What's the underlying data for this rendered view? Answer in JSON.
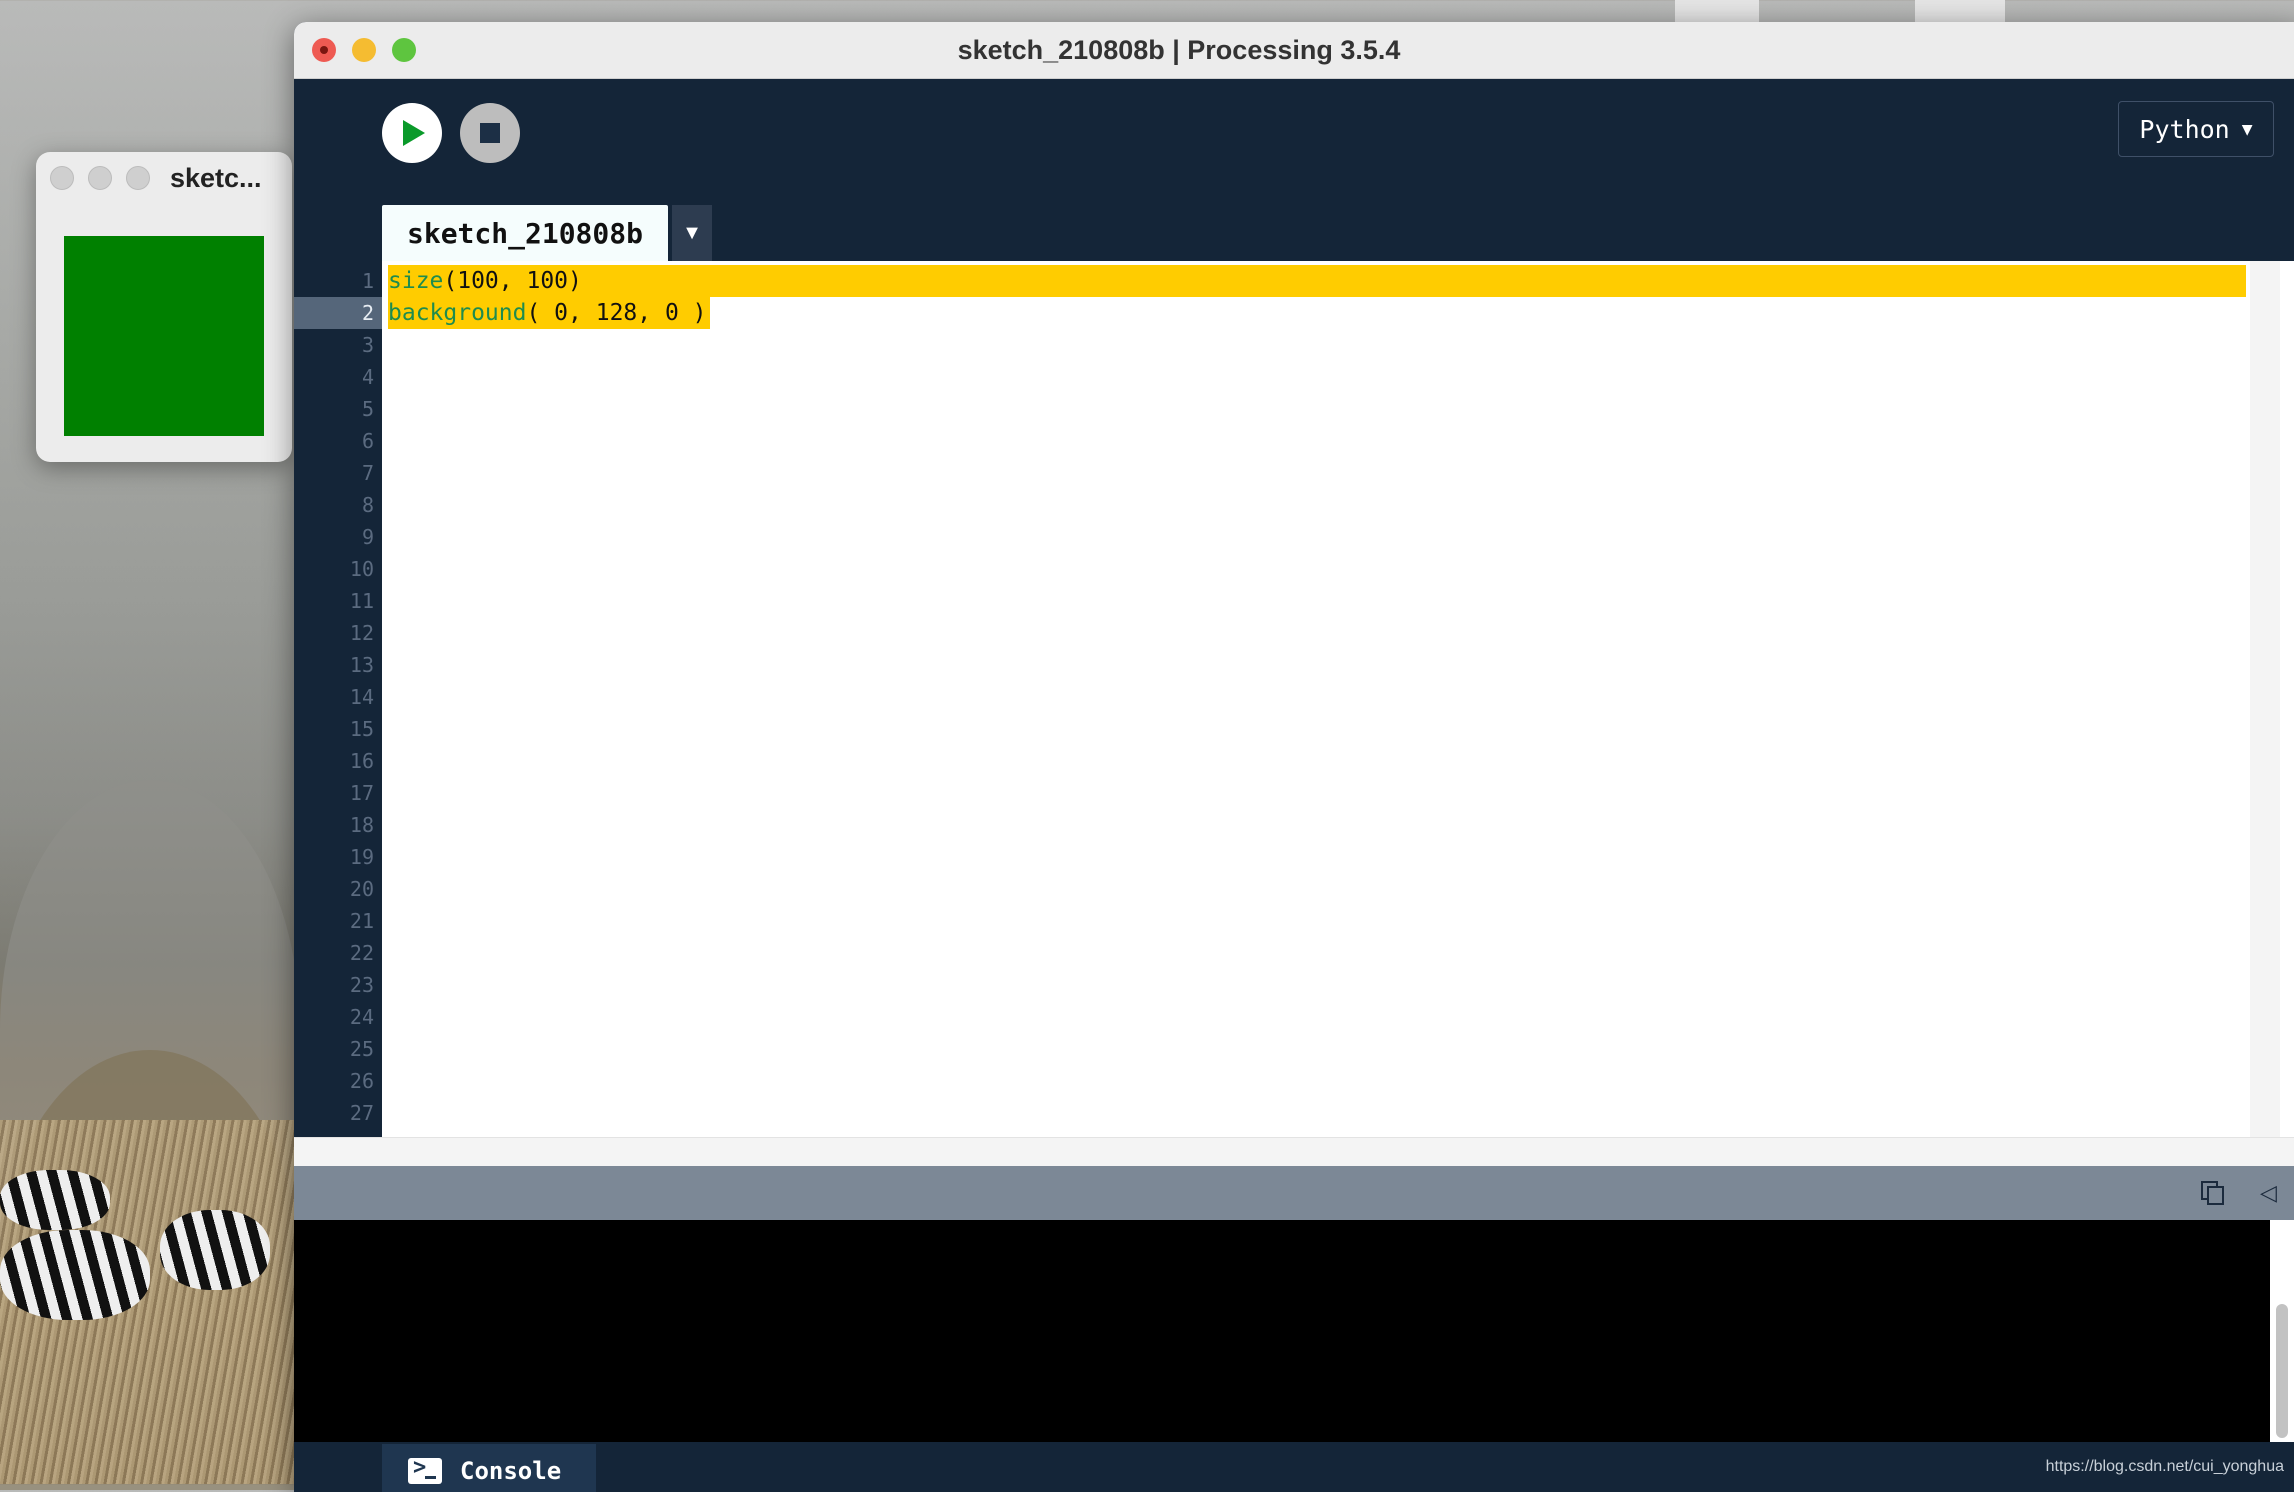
{
  "main_window": {
    "title": "sketch_210808b | Processing 3.5.4",
    "mode": "Python",
    "mode_arrow": "▼",
    "tab": {
      "label": "sketch_210808b",
      "menu_arrow": "▼"
    },
    "code_lines": [
      {
        "fn": "size",
        "rest": "(100, 100)"
      },
      {
        "fn": "background",
        "rest": "( 0, 128, 0 )"
      }
    ],
    "line_numbers": [
      "1",
      "2",
      "3",
      "4",
      "5",
      "6",
      "7",
      "8",
      "9",
      "10",
      "11",
      "12",
      "13",
      "14",
      "15",
      "16",
      "17",
      "18",
      "19",
      "20",
      "21",
      "22",
      "23",
      "24",
      "25",
      "26",
      "27"
    ],
    "console_tab_label": "Console"
  },
  "sketch_window": {
    "title": "sketc...",
    "canvas_color": "#008000"
  },
  "watermark": "https://blog.csdn.net/cui_yonghua",
  "icons": {
    "run": "play-icon",
    "stop": "stop-icon",
    "copy": "copy-icon",
    "collapse": "collapse-triangle-icon",
    "console": "terminal-icon"
  },
  "colors": {
    "accent_highlight": "#ffcc00",
    "toolbar_bg": "#142538",
    "keyword": "#1e8c4e"
  }
}
